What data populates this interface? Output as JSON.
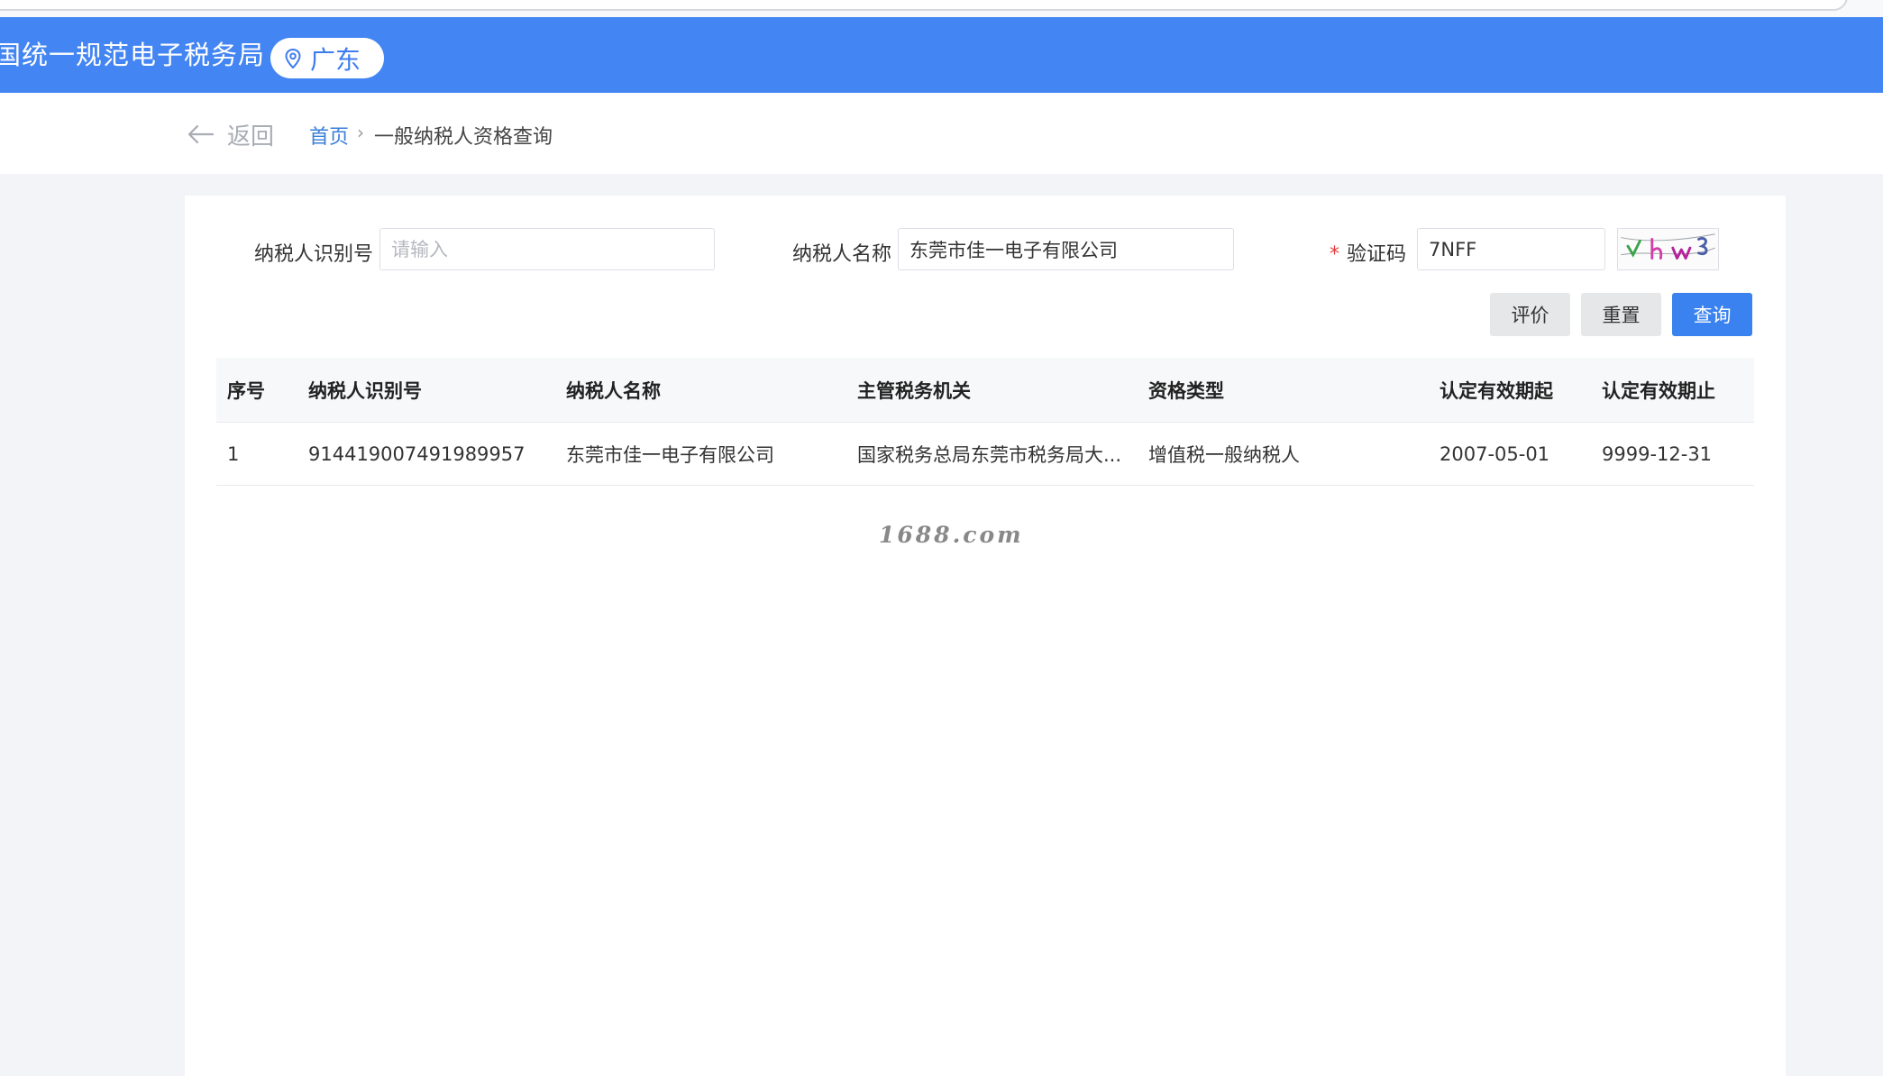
{
  "header": {
    "site_title": "国统一规范电子税务局",
    "region": "广东"
  },
  "breadcrumb": {
    "back_label": "返回",
    "home": "首页",
    "separator": "›",
    "current": "一般纳税人资格查询"
  },
  "form": {
    "taxpayer_id_label": "纳税人识别号",
    "taxpayer_id_placeholder": "请输入",
    "taxpayer_id_value": "",
    "taxpayer_name_label": "纳税人名称",
    "taxpayer_name_value": "东莞市佳一电子有限公司",
    "captcha_required_mark": "*",
    "captcha_label": "验证码",
    "captcha_value": "7NFF"
  },
  "buttons": {
    "evaluate": "评价",
    "reset": "重置",
    "query": "查询"
  },
  "table": {
    "columns": [
      "序号",
      "纳税人识别号",
      "纳税人名称",
      "主管税务机关",
      "资格类型",
      "认定有效期起",
      "认定有效期止"
    ],
    "rows": [
      [
        "1",
        "914419007491989957",
        "东莞市佳一电子有限公司",
        "国家税务总局东莞市税务局大...",
        "增值税一般纳税人",
        "2007-05-01",
        "9999-12-31"
      ]
    ]
  },
  "watermark": "1688.com",
  "colors": {
    "header_blue": "#4385f2",
    "primary_button": "#3a82ef",
    "link": "#3a7fd8",
    "required": "#e23c3c"
  },
  "icons": {
    "location": "location-pin-icon",
    "back": "arrow-left-icon"
  }
}
